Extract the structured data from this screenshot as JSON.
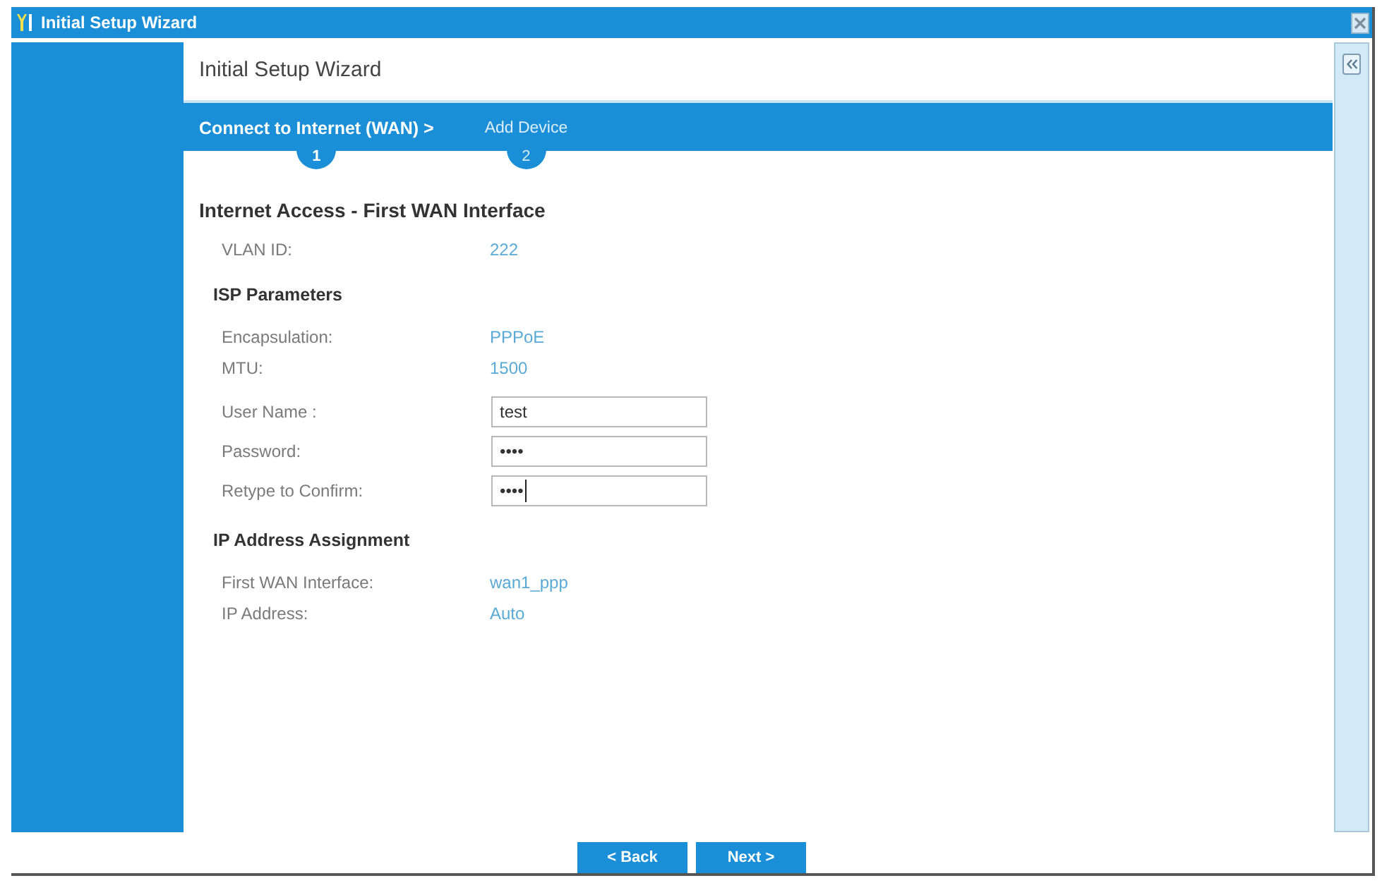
{
  "window": {
    "title": "Initial Setup Wizard"
  },
  "wizard": {
    "title": "Initial Setup Wizard",
    "steps": [
      {
        "label": "Connect to Internet (WAN) >",
        "number": "1",
        "selected": true
      },
      {
        "label": "Add Device",
        "number": "2",
        "selected": false
      }
    ],
    "sections": [
      {
        "kind": "main",
        "title": "Internet Access - First WAN Interface",
        "rows": [
          {
            "kind": "text",
            "label": "VLAN ID:",
            "value": "222"
          }
        ]
      },
      {
        "kind": "sub",
        "title": "ISP Parameters",
        "rows": [
          {
            "kind": "text",
            "label": "Encapsulation:",
            "value": "PPPoE"
          },
          {
            "kind": "text",
            "label": "MTU:",
            "value": "1500"
          },
          {
            "kind": "input",
            "label": "User Name :",
            "value": "test",
            "focused": false
          },
          {
            "kind": "input",
            "label": "Password:",
            "value": "••••",
            "focused": false
          },
          {
            "kind": "input",
            "label": "Retype to Confirm:",
            "value": "••••",
            "focused": true
          }
        ]
      },
      {
        "kind": "sub",
        "title": "IP Address Assignment",
        "rows": [
          {
            "kind": "text",
            "label": "First WAN Interface:",
            "value": "wan1_ppp"
          },
          {
            "kind": "text",
            "label": "IP Address:",
            "value": "Auto"
          }
        ]
      }
    ]
  },
  "buttons": [
    "< Back",
    "Next >"
  ]
}
